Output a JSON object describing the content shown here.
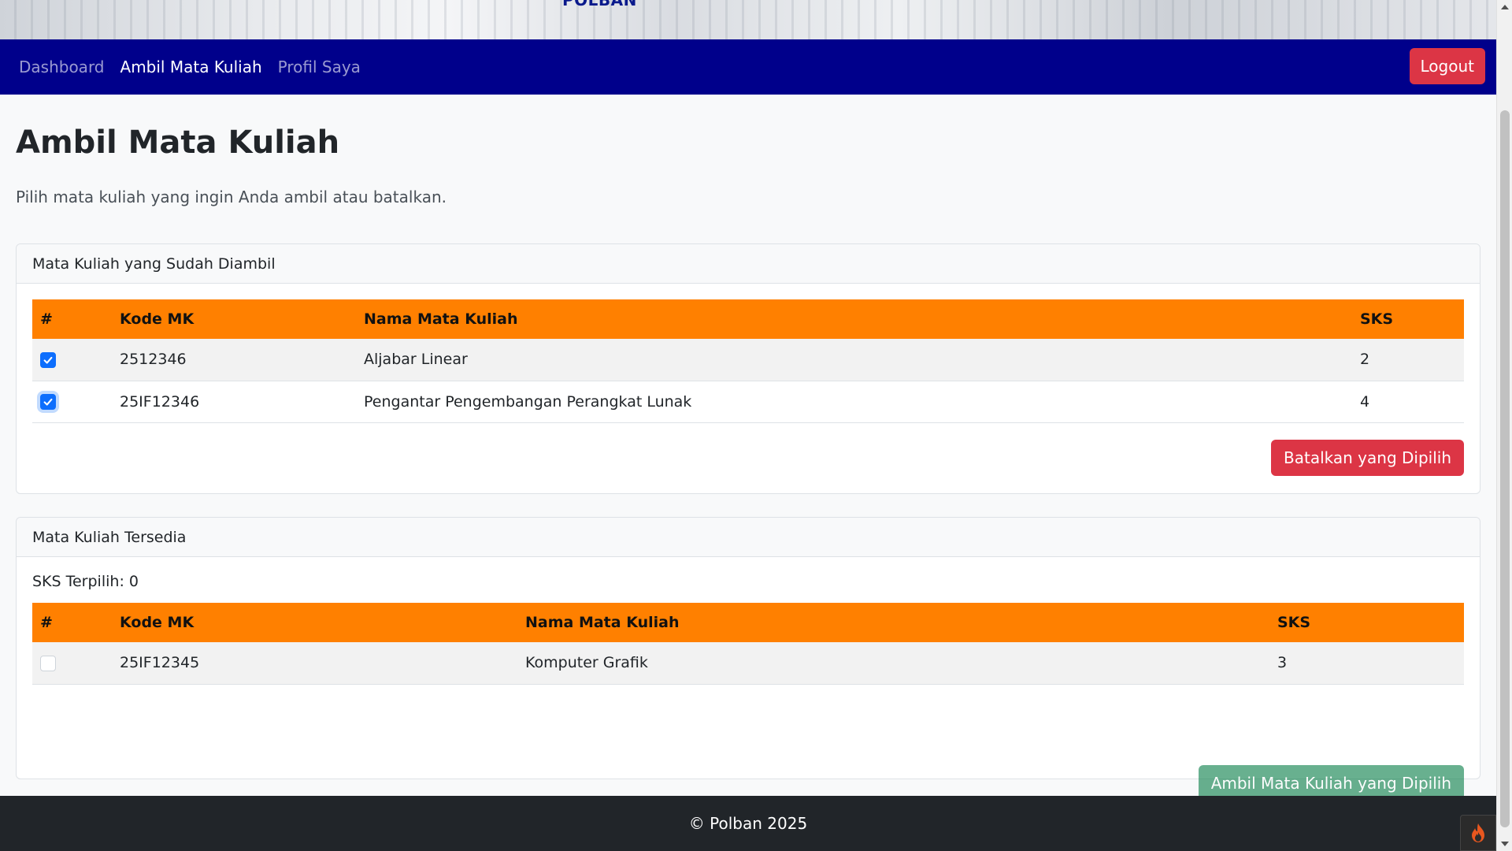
{
  "hero": {
    "brand": "POLBAN"
  },
  "navbar": {
    "links": [
      {
        "label": "Dashboard",
        "active": false
      },
      {
        "label": "Ambil Mata Kuliah",
        "active": true
      },
      {
        "label": "Profil Saya",
        "active": false
      }
    ],
    "logout_label": "Logout"
  },
  "page": {
    "title": "Ambil Mata Kuliah",
    "lead": "Pilih mata kuliah yang ingin Anda ambil atau batalkan."
  },
  "taken": {
    "header": "Mata Kuliah yang Sudah Diambil",
    "columns": [
      "#",
      "Kode MK",
      "Nama Mata Kuliah",
      "SKS"
    ],
    "rows": [
      {
        "checked": true,
        "kode": "2512346",
        "nama": "Aljabar Linear",
        "sks": "2"
      },
      {
        "checked": true,
        "kode": "25IF12346",
        "nama": "Pengantar Pengembangan Perangkat Lunak",
        "sks": "4"
      }
    ],
    "cancel_label": "Batalkan yang Dipilih"
  },
  "available": {
    "header": "Mata Kuliah Tersedia",
    "sks_label": "SKS Terpilih: 0",
    "columns": [
      "#",
      "Kode MK",
      "Nama Mata Kuliah",
      "SKS"
    ],
    "rows": [
      {
        "checked": false,
        "kode": "25IF12345",
        "nama": "Komputer Grafik",
        "sks": "3"
      }
    ],
    "submit_label": "Ambil Mata Kuliah yang Dipilih"
  },
  "footer": {
    "text": "© Polban 2025"
  },
  "colors": {
    "navbar": "#00008b",
    "table_header": "#ff8000",
    "danger": "#dc3545",
    "success": "#198754",
    "checkbox": "#0d6efd",
    "footer": "#212529"
  },
  "icons": {
    "checkbox_checked": "check-icon",
    "extension": "flame-icon"
  }
}
